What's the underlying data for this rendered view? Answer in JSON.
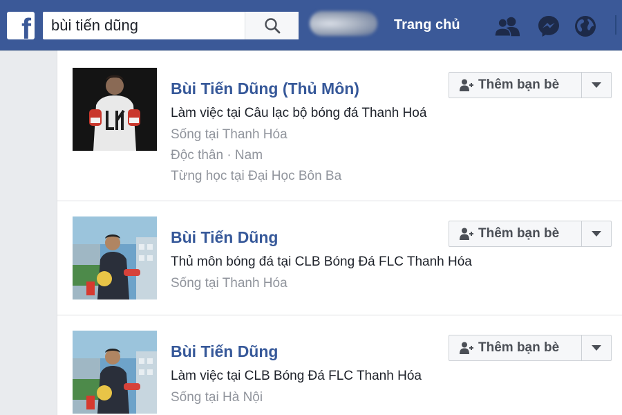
{
  "header": {
    "search_value": "bùi tiến dũng",
    "home_label": "Trang chủ"
  },
  "colors": {
    "brand": "#3b5998",
    "link": "#365899",
    "muted": "#90949c"
  },
  "results": [
    {
      "name": "Bùi Tiến Dũng (Thủ Môn)",
      "lines": [
        "Làm việc tại Câu lạc bộ bóng đá Thanh Hoá",
        "Sống tại Thanh Hóa",
        "Độc thân · Nam",
        "Từng học tại Đại Học Bôn Ba"
      ],
      "button": "Thêm bạn bè"
    },
    {
      "name": "Bùi Tiến Dũng",
      "lines": [
        "Thủ môn bóng đá tại CLB Bóng Đá FLC Thanh Hóa",
        "Sống tại Thanh Hóa"
      ],
      "button": "Thêm bạn bè"
    },
    {
      "name": "Bùi Tiến Dũng",
      "lines": [
        "Làm việc tại CLB Bóng Đá FLC Thanh Hóa",
        "Sống tại Hà Nội"
      ],
      "button": "Thêm bạn bè"
    }
  ]
}
